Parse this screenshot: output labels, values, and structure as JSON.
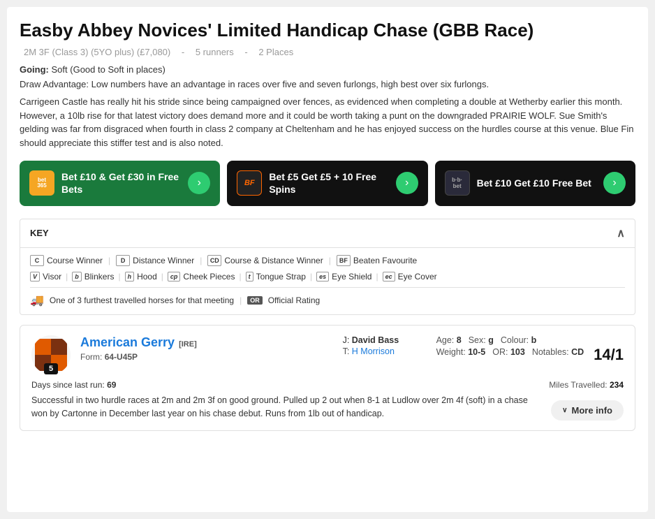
{
  "race": {
    "title": "Easby Abbey Novices' Limited Handicap Chase (GBB Race)",
    "meta": {
      "distance": "2M 3F (Class 3) (5YO plus) (£7,080)",
      "separator1": "-",
      "runners": "5 runners",
      "separator2": "-",
      "places": "2 Places"
    },
    "going_label": "Going:",
    "going_value": "Soft (Good to Soft in places)",
    "draw_label": "Draw Advantage:",
    "draw_value": "Low numbers have an advantage in races over five and seven furlongs, high best over six furlongs.",
    "analysis": "Carrigeen Castle has really hit his stride since being campaigned over fences, as evidenced when completing a double at Wetherby earlier this month. However, a 10lb rise for that latest victory does demand more and it could be worth taking a punt on the downgraded PRAIRIE WOLF. Sue Smith's gelding was far from disgraced when fourth in class 2 company at Cheltenham and he has enjoyed success on the hurdles course at this venue. Blue Fin should appreciate this stiffer test and is also noted."
  },
  "banners": [
    {
      "bg": "green",
      "logo_text": "bet\n365",
      "logo_type": "bet365",
      "text": "Bet £10 & Get £30 in Free Bets",
      "id": "bet365"
    },
    {
      "bg": "dark",
      "logo_text": "BF",
      "logo_type": "betfair",
      "text": "Bet £5 Get £5 + 10 Free Spins",
      "id": "betfair"
    },
    {
      "bg": "dark",
      "logo_text": "b·b·",
      "logo_type": "bbbet",
      "text": "Bet £10 Get £10 Free Bet",
      "id": "bbbet"
    }
  ],
  "key": {
    "label": "KEY",
    "items_row1": [
      {
        "badge": "C",
        "label": "Course Winner"
      },
      {
        "badge": "D",
        "label": "Distance Winner"
      },
      {
        "badge": "CD",
        "label": "Course & Distance Winner"
      },
      {
        "badge": "BF",
        "label": "Beaten Favourite"
      }
    ],
    "items_row2": [
      {
        "badge": "V",
        "label": "Visor"
      },
      {
        "badge": "b",
        "label": "Blinkers"
      },
      {
        "badge": "h",
        "label": "Hood"
      },
      {
        "badge": "cp",
        "label": "Cheek Pieces"
      },
      {
        "badge": "t",
        "label": "Tongue Strap"
      },
      {
        "badge": "es",
        "label": "Eye Shield"
      },
      {
        "badge": "ec",
        "label": "Eye Cover"
      }
    ],
    "travel_text": "One of 3 furthest travelled horses for that meeting",
    "or_label": "OR",
    "or_text": "Official Rating"
  },
  "horse": {
    "number": "5",
    "name": "American Gerry",
    "country": "[IRE]",
    "jockey_label": "J:",
    "jockey": "David Bass",
    "trainer_label": "T:",
    "trainer": "H Morrison",
    "age_label": "Age:",
    "age": "8",
    "sex_label": "Sex:",
    "sex": "g",
    "colour_label": "Colour:",
    "colour": "b",
    "weight_label": "Weight:",
    "weight": "10-5",
    "or_label": "OR:",
    "or_value": "103",
    "notables_label": "Notables:",
    "notables": "CD",
    "form_label": "Form:",
    "form": "64-U45P",
    "odds": "14/1",
    "days_since_label": "Days since last run:",
    "days_since": "69",
    "miles_travelled_label": "Miles Travelled:",
    "miles_travelled": "234",
    "analysis": "Successful in two hurdle races at 2m and 2m 3f on good ground. Pulled up 2 out when 8-1 at Ludlow over 2m 4f (soft) in a chase won by Cartonne in December last year on his chase debut. Runs from 1lb out of handicap.",
    "more_info": "More info"
  }
}
